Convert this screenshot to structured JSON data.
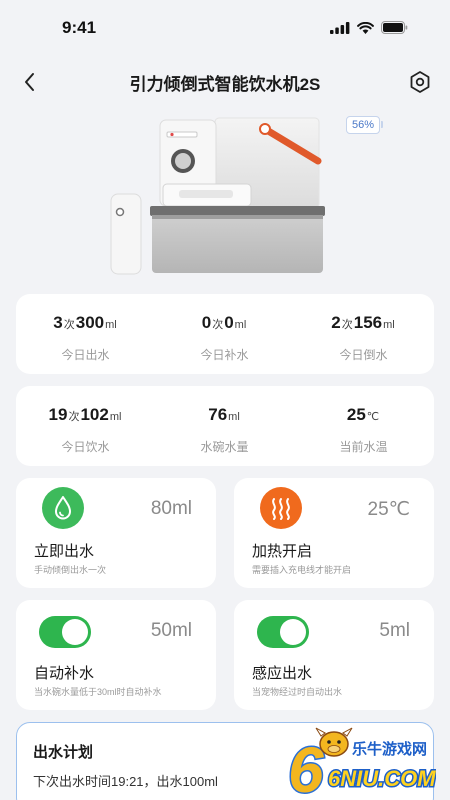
{
  "status_bar": {
    "time": "9:41"
  },
  "header": {
    "title": "引力倾倒式智能饮水机2S"
  },
  "device": {
    "battery_percent": "56%"
  },
  "stats_row1": [
    {
      "count": "3",
      "count_unit": "次",
      "amount": "300",
      "amount_unit": "ml",
      "label": "今日出水"
    },
    {
      "count": "0",
      "count_unit": "次",
      "amount": "0",
      "amount_unit": "ml",
      "label": "今日补水"
    },
    {
      "count": "2",
      "count_unit": "次",
      "amount": "156",
      "amount_unit": "ml",
      "label": "今日倒水"
    }
  ],
  "stats_row2": [
    {
      "count": "19",
      "count_unit": "次",
      "amount": "102",
      "amount_unit": "ml",
      "label": "今日饮水"
    },
    {
      "amount": "76",
      "amount_unit": "ml",
      "label": "水碗水量"
    },
    {
      "amount": "25",
      "amount_unit": "℃",
      "label": "当前水温"
    }
  ],
  "tiles": {
    "dispense": {
      "value": "80ml",
      "title": "立即出水",
      "subtitle": "手动倾倒出水一次",
      "icon": "water-drop-icon",
      "color": "#3dba5b"
    },
    "heating": {
      "value": "25℃",
      "title": "加热开启",
      "subtitle": "需要插入充电线才能开启",
      "icon": "heat-waves-icon",
      "color": "#f06a1d"
    },
    "auto_refill": {
      "value": "50ml",
      "title": "自动补水",
      "subtitle": "当水碗水量低于30ml时自动补水",
      "enabled": true
    },
    "sensor_dispense": {
      "value": "5ml",
      "title": "感应出水",
      "subtitle": "当宠物经过时自动出水",
      "enabled": true
    }
  },
  "plan": {
    "title": "出水计划",
    "description": "下次出水时间19:21，出水100ml"
  },
  "watermark": {
    "text": "乐牛游戏网",
    "brand": "6NIU.COM"
  }
}
